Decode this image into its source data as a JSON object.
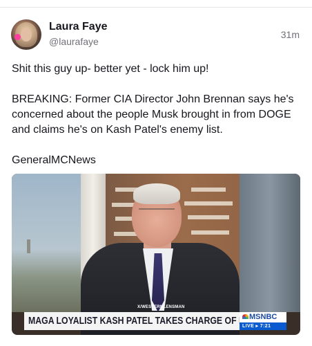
{
  "post": {
    "author": {
      "display_name": "Laura Faye",
      "handle": "@laurafaye",
      "avatar_icon": "avatar-photo"
    },
    "timestamp": "31m",
    "paragraphs": [
      "Shit this guy up- better yet - lock him up!",
      "BREAKING: Former CIA Director John Brennan says he's concerned about the people Musk brought in from DOGE and claims he's on Kash Patel's enemy list.",
      "GeneralMCNews"
    ],
    "media": {
      "watermark": "X/WESTERNLENSMAN",
      "chyron": "MAGA LOYALIST KASH PATEL TAKES CHARGE OF FBI",
      "network_logo": "MSNBC",
      "live_label": "LIVE",
      "live_time": "7:21",
      "colors": {
        "chyron_bg": "#f4f4f4",
        "live_bar": "#0a5bd0",
        "logo_text": "#1a4aa3"
      }
    }
  }
}
